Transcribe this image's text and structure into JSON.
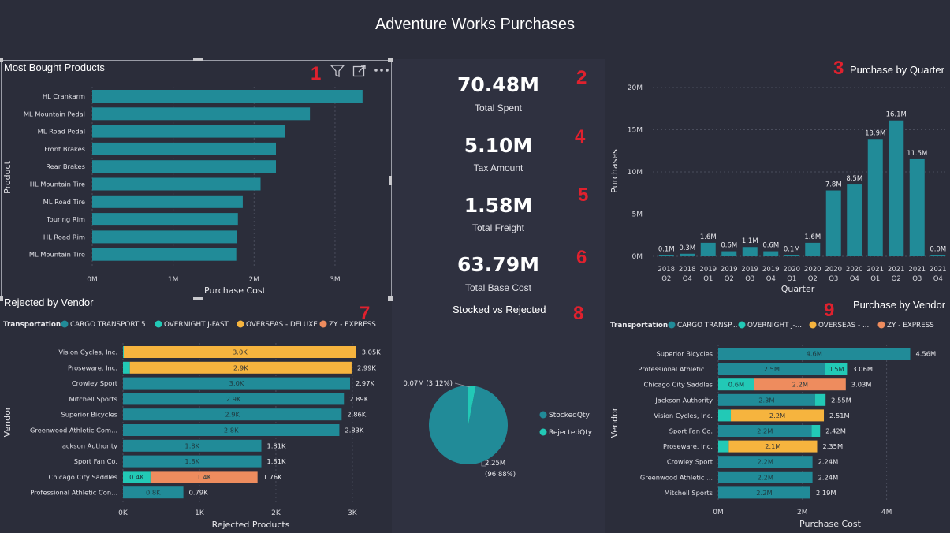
{
  "page_title": "Adventure Works Purchases",
  "badges": [
    "1",
    "2",
    "3",
    "4",
    "5",
    "6",
    "7",
    "8",
    "9"
  ],
  "colors": {
    "teal": "#218b98",
    "cyan": "#22c9b6",
    "orange": "#f6b43e",
    "salmon": "#ee8c5e",
    "badge": "#e0212e",
    "background": "#2b2d3a"
  },
  "kpis": [
    {
      "value": "70.48M",
      "label": "Total Spent"
    },
    {
      "value": "5.10M",
      "label": "Tax Amount"
    },
    {
      "value": "1.58M",
      "label": "Total Freight"
    },
    {
      "value": "63.79M",
      "label": "Total Base Cost"
    }
  ],
  "visual_header_icons": [
    "filter-icon",
    "focus-mode-icon",
    "more-options-icon"
  ],
  "legend_title": "Transportation",
  "legend_items_full": [
    "CARGO TRANSPORT 5",
    "OVERNIGHT J-FAST",
    "OVERSEAS - DELUXE",
    "ZY - EXPRESS"
  ],
  "legend_items_short": [
    "CARGO TRANSP...",
    "OVERNIGHT J-...",
    "OVERSEAS - ...",
    "ZY - EXPRESS"
  ],
  "chart_data": [
    {
      "id": "most-bought-products",
      "type": "bar",
      "orientation": "horizontal",
      "title": "Most Bought Products",
      "xlabel": "Purchase Cost",
      "ylabel": "Product",
      "categories": [
        "HL Crankarm",
        "ML Mountain Pedal",
        "ML Road Pedal",
        "Front Brakes",
        "Rear Brakes",
        "HL Mountain Tire",
        "ML Road Tire",
        "Touring Rim",
        "HL Road Rim",
        "ML Mountain Tire"
      ],
      "values": [
        3.34,
        2.69,
        2.38,
        2.27,
        2.27,
        2.08,
        1.86,
        1.8,
        1.79,
        1.78
      ],
      "value_unit": "M",
      "xticks": [
        "0M",
        "1M",
        "2M",
        "3M"
      ],
      "xlim": [
        0,
        3.4
      ],
      "grid": true
    },
    {
      "id": "purchase-by-quarter",
      "type": "bar",
      "title": "Purchase by Quarter",
      "xlabel": "Quarter",
      "ylabel": "Purchases",
      "categories": [
        [
          "2018",
          "Q2"
        ],
        [
          "2018",
          "Q4"
        ],
        [
          "2019",
          "Q1"
        ],
        [
          "2019",
          "Q2"
        ],
        [
          "2019",
          "Q3"
        ],
        [
          "2019",
          "Q4"
        ],
        [
          "2020",
          "Q1"
        ],
        [
          "2020",
          "Q2"
        ],
        [
          "2020",
          "Q3"
        ],
        [
          "2020",
          "Q4"
        ],
        [
          "2021",
          "Q1"
        ],
        [
          "2021",
          "Q2"
        ],
        [
          "2021",
          "Q3"
        ],
        [
          "2021",
          "Q4"
        ]
      ],
      "values": [
        0.1,
        0.3,
        1.6,
        0.6,
        1.1,
        0.6,
        0.1,
        1.6,
        7.8,
        8.5,
        13.9,
        16.1,
        11.5,
        0.0
      ],
      "labels": [
        "0.1M",
        "0.3M",
        "1.6M",
        "0.6M",
        "1.1M",
        "0.6M",
        "0.1M",
        "1.6M",
        "7.8M",
        "8.5M",
        "13.9M",
        "16.1M",
        "11.5M",
        "0.0M"
      ],
      "yticks": [
        "0M",
        "5M",
        "10M",
        "15M",
        "20M"
      ],
      "ylim": [
        0,
        20
      ],
      "grid": true
    },
    {
      "id": "rejected-by-vendor",
      "type": "bar",
      "orientation": "horizontal",
      "stacked": true,
      "title": "Rejected by Vendor",
      "xlabel": "Rejected Products",
      "ylabel": "Vendor",
      "categories": [
        "Vision Cycles, Inc.",
        "Proseware, Inc.",
        "Crowley Sport",
        "Mitchell Sports",
        "Superior Bicycles",
        "Greenwood Athletic Com...",
        "Jackson Authority",
        "Sport Fan Co.",
        "Chicago City Saddles",
        "Professional Athletic Con..."
      ],
      "series": [
        {
          "name": "CARGO TRANSPORT 5",
          "values": [
            0,
            0,
            2.97,
            2.89,
            2.86,
            2.83,
            1.81,
            1.81,
            0,
            0.79
          ],
          "labels": [
            "",
            "",
            "3.0K",
            "2.9K",
            "2.9K",
            "2.8K",
            "1.8K",
            "1.8K",
            "",
            "0.8K"
          ]
        },
        {
          "name": "OVERNIGHT J-FAST",
          "values": [
            0.01,
            0.09,
            0,
            0,
            0,
            0,
            0,
            0,
            0.36,
            0
          ],
          "labels": [
            "",
            "",
            "",
            "",
            "",
            "",
            "",
            "",
            "0.4K",
            ""
          ]
        },
        {
          "name": "OVERSEAS - DELUXE",
          "values": [
            3.04,
            2.9,
            0,
            0,
            0,
            0,
            0,
            0,
            0,
            0
          ],
          "labels": [
            "3.0K",
            "2.9K",
            "",
            "",
            "",
            "",
            "",
            "",
            "",
            ""
          ]
        },
        {
          "name": "ZY - EXPRESS",
          "values": [
            0,
            0,
            0,
            0,
            0,
            0,
            0,
            0,
            1.4,
            0
          ],
          "labels": [
            "",
            "",
            "",
            "",
            "",
            "",
            "",
            "",
            "1.4K",
            ""
          ]
        }
      ],
      "totals": [
        "3.05K",
        "2.99K",
        "2.97K",
        "2.89K",
        "2.86K",
        "2.83K",
        "1.81K",
        "1.81K",
        "1.76K",
        "0.79K"
      ],
      "xticks": [
        "0K",
        "1K",
        "2K",
        "3K"
      ],
      "xlim": [
        0,
        3.3
      ],
      "grid": true
    },
    {
      "id": "stocked-vs-rejected",
      "type": "pie",
      "title": "Stocked vs Rejected",
      "slices": [
        {
          "name": "StockedQty",
          "value": 2.25,
          "label": "2.25M (96.88%)",
          "label_lines": [
            "2.25M",
            "(96.88%)"
          ]
        },
        {
          "name": "RejectedQty",
          "value": 0.07,
          "label": "0.07M (3.12%)"
        }
      ],
      "legend": [
        "StockedQty",
        "RejectedQty"
      ],
      "legend_position": "right"
    },
    {
      "id": "purchase-by-vendor",
      "type": "bar",
      "orientation": "horizontal",
      "stacked": true,
      "title": "Purchase by Vendor",
      "xlabel": "Purchase Cost",
      "ylabel": "Vendor",
      "categories": [
        "Superior Bicycles",
        "Professional Athletic ...",
        "Chicago City Saddles",
        "Jackson Authority",
        "Vision Cycles, Inc.",
        "Sport Fan Co.",
        "Proseware, Inc.",
        "Crowley Sport",
        "Greenwood Athletic ...",
        "Mitchell Sports"
      ],
      "series": [
        {
          "name": "CARGO TRANSPORT 5",
          "values": [
            4.56,
            2.54,
            0,
            2.3,
            0,
            2.22,
            0,
            2.24,
            2.24,
            2.19
          ],
          "labels": [
            "4.6M",
            "2.5M",
            "",
            "2.3M",
            "",
            "2.2M",
            "",
            "2.2M",
            "2.2M",
            "2.2M"
          ]
        },
        {
          "name": "OVERNIGHT J-FAST",
          "values": [
            0,
            0.52,
            0.86,
            0.25,
            0.3,
            0.2,
            0.25,
            0,
            0,
            0
          ],
          "labels": [
            "",
            "0.5M",
            "0.6M",
            "",
            "",
            "",
            "",
            "",
            "",
            ""
          ]
        },
        {
          "name": "OVERSEAS - DELUXE",
          "values": [
            0,
            0,
            0,
            0,
            2.21,
            0,
            2.1,
            0,
            0,
            0
          ],
          "labels": [
            "",
            "",
            "",
            "",
            "2.2M",
            "",
            "2.1M",
            "",
            "",
            ""
          ]
        },
        {
          "name": "ZY - EXPRESS",
          "values": [
            0,
            0,
            2.17,
            0,
            0,
            0,
            0,
            0,
            0,
            0
          ],
          "labels": [
            "",
            "",
            "2.2M",
            "",
            "",
            "",
            "",
            "",
            "",
            ""
          ]
        }
      ],
      "totals": [
        "4.56M",
        "3.06M",
        "3.03M",
        "2.55M",
        "2.51M",
        "2.42M",
        "2.35M",
        "2.24M",
        "2.24M",
        "2.19M"
      ],
      "xticks": [
        "0M",
        "2M",
        "4M"
      ],
      "xlim": [
        0,
        5
      ],
      "grid": true
    }
  ]
}
